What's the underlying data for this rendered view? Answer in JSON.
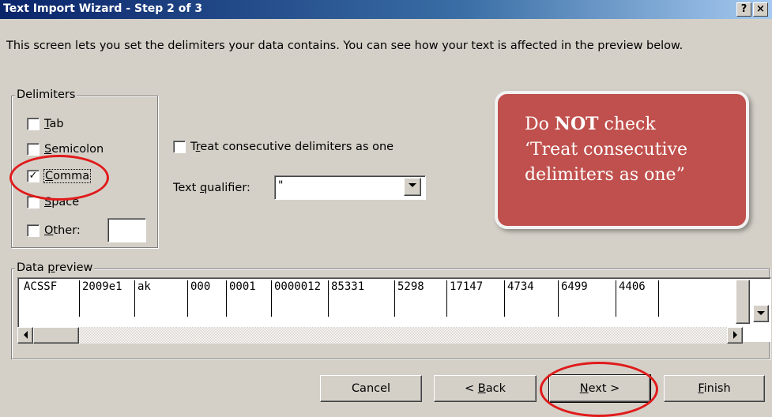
{
  "window": {
    "title": "Text Import Wizard - Step 2 of 3",
    "help_label": "?",
    "close_label": "×"
  },
  "intro_text": "This screen lets you set the delimiters your data contains.  You can see how your text is affected in the preview below.",
  "delimiters": {
    "legend": "Delimiters",
    "options": [
      {
        "label_u": "T",
        "label_rest": "ab",
        "checked": false
      },
      {
        "label_u": "S",
        "label_rest": "emicolon",
        "checked": false
      },
      {
        "label_u": "C",
        "label_rest": "omma",
        "checked": true
      },
      {
        "label_u": "S",
        "label_rest": "pace",
        "checked": false
      },
      {
        "label_u": "O",
        "label_rest": "ther:",
        "checked": false
      }
    ],
    "other_value": ""
  },
  "consecutive": {
    "label_pre": "T",
    "label_u": "r",
    "label_rest": "eat consecutive delimiters as one",
    "checked": false
  },
  "qualifier": {
    "label_pre": "Text ",
    "label_u": "q",
    "label_rest": "ualifier:",
    "value": "\""
  },
  "preview": {
    "legend_pre": "Data ",
    "legend_u": "p",
    "legend_rest": "review",
    "cells": [
      "ACSSF",
      "2009e1",
      "ak",
      "000",
      "0001",
      "0000012",
      "85331",
      "5298",
      "17147",
      "4734",
      "6499",
      "4406"
    ]
  },
  "buttons": {
    "cancel": "Cancel",
    "back_pre": "< ",
    "back_u": "B",
    "back_rest": "ack",
    "next_u": "N",
    "next_rest": "ext >",
    "finish_u": "F",
    "finish_rest": "inish"
  },
  "callout": {
    "line1_pre": "Do ",
    "line1_bold": "NOT",
    "line1_post": " check",
    "line2": "‘Treat consecutive",
    "line3": "delimiters as one”"
  },
  "colors": {
    "titlebar": "#0a246a",
    "callout_fill": "#c0504d",
    "highlight_oval": "#e01b1b",
    "dialog_face": "#d4d0c8"
  }
}
